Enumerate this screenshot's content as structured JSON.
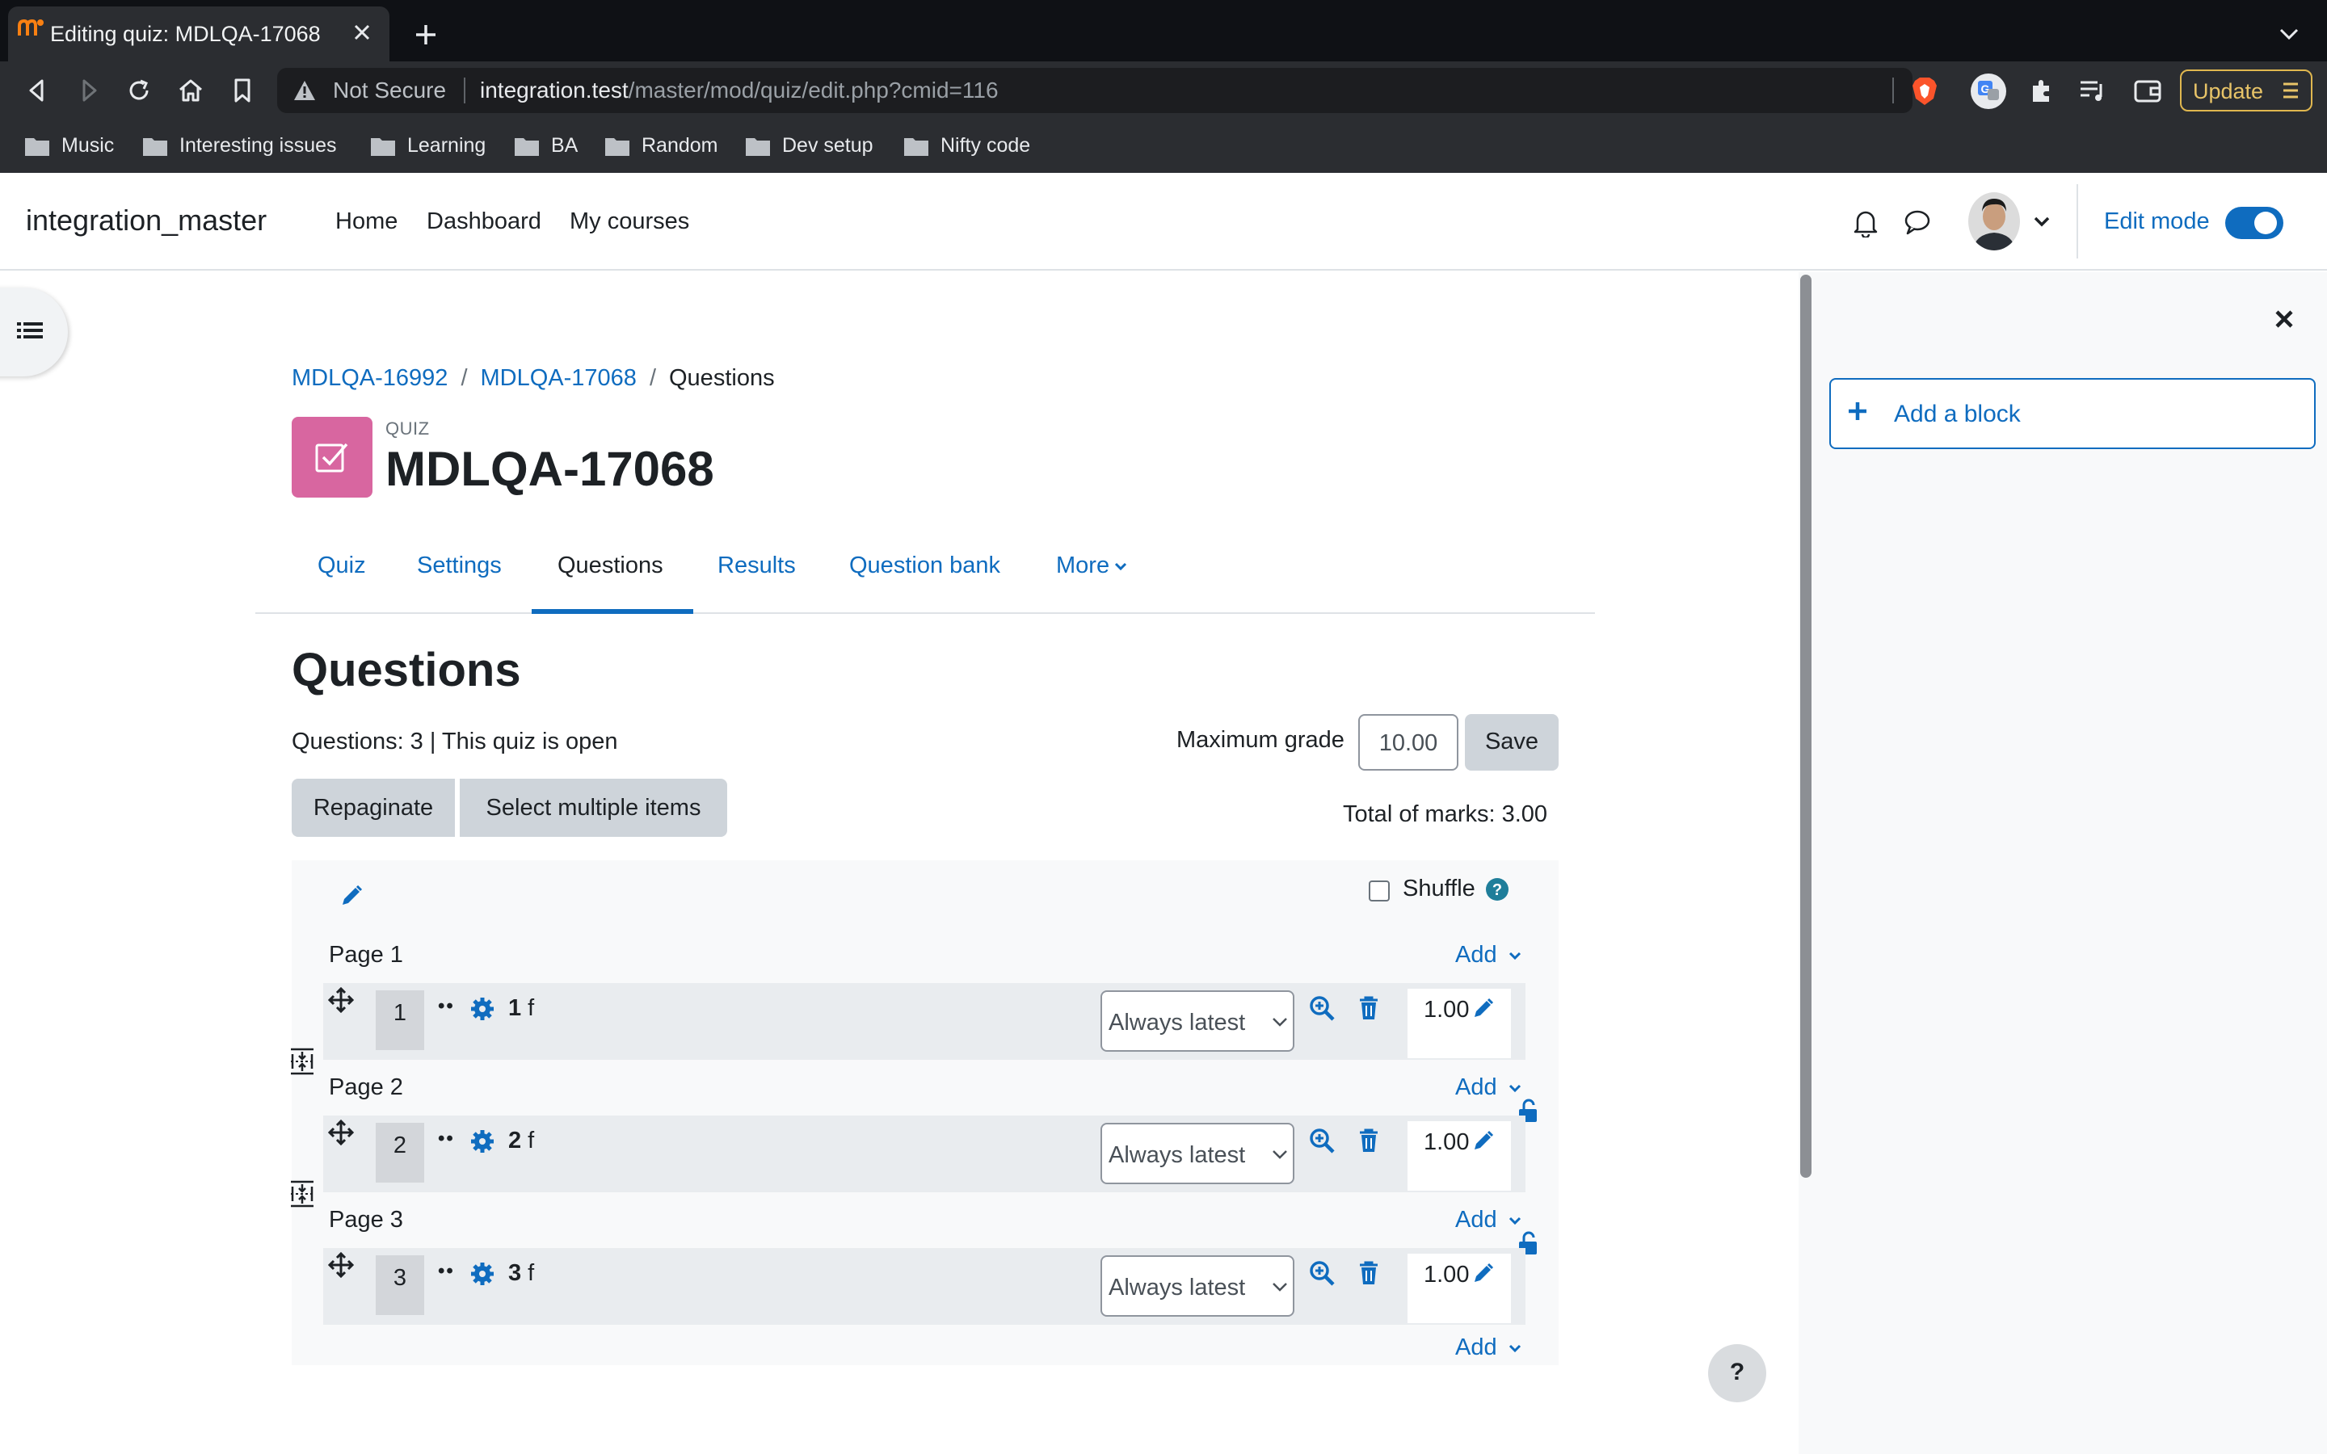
{
  "browser": {
    "tab_title": "Editing quiz: MDLQA-17068",
    "security_label": "Not Secure",
    "url_host": "integration.test",
    "url_path": "/master/mod/quiz/edit.php?cmid=116",
    "update_label": "Update",
    "bookmarks": [
      "Music",
      "Interesting issues",
      "Learning",
      "BA",
      "Random",
      "Dev setup",
      "Nifty code"
    ]
  },
  "navbar": {
    "site_name": "integration_master",
    "items": [
      "Home",
      "Dashboard",
      "My courses"
    ],
    "edit_mode_label": "Edit mode"
  },
  "drawer": {
    "add_block_label": "Add a block"
  },
  "breadcrumb": [
    "MDLQA-16992",
    "MDLQA-17068",
    "Questions"
  ],
  "activity": {
    "type_label": "QUIZ",
    "title": "MDLQA-17068"
  },
  "secondary_nav": {
    "items": [
      "Quiz",
      "Settings",
      "Questions",
      "Results",
      "Question bank",
      "More"
    ],
    "active": "Questions"
  },
  "page": {
    "heading": "Questions",
    "status": "Questions: 3 | This quiz is open",
    "max_grade_label": "Maximum grade",
    "max_grade_value": "10.00",
    "save_label": "Save",
    "repaginate_label": "Repaginate",
    "select_multiple_label": "Select multiple items",
    "total_marks": "Total of marks: 3.00",
    "shuffle_label": "Shuffle",
    "add_label": "Add",
    "pages": [
      {
        "label": "Page 1",
        "slot": "1",
        "qnum": "1",
        "qname": "f",
        "version": "Always latest",
        "mark": "1.00"
      },
      {
        "label": "Page 2",
        "slot": "2",
        "qnum": "2",
        "qname": "f",
        "version": "Always latest",
        "mark": "1.00"
      },
      {
        "label": "Page 3",
        "slot": "3",
        "qnum": "3",
        "qname": "f",
        "version": "Always latest",
        "mark": "1.00"
      }
    ]
  },
  "help_label": "?",
  "colors": {
    "brand": "#0f6cbf",
    "quiz_icon": "#d866a0",
    "chrome_dark": "#2b2d31"
  }
}
